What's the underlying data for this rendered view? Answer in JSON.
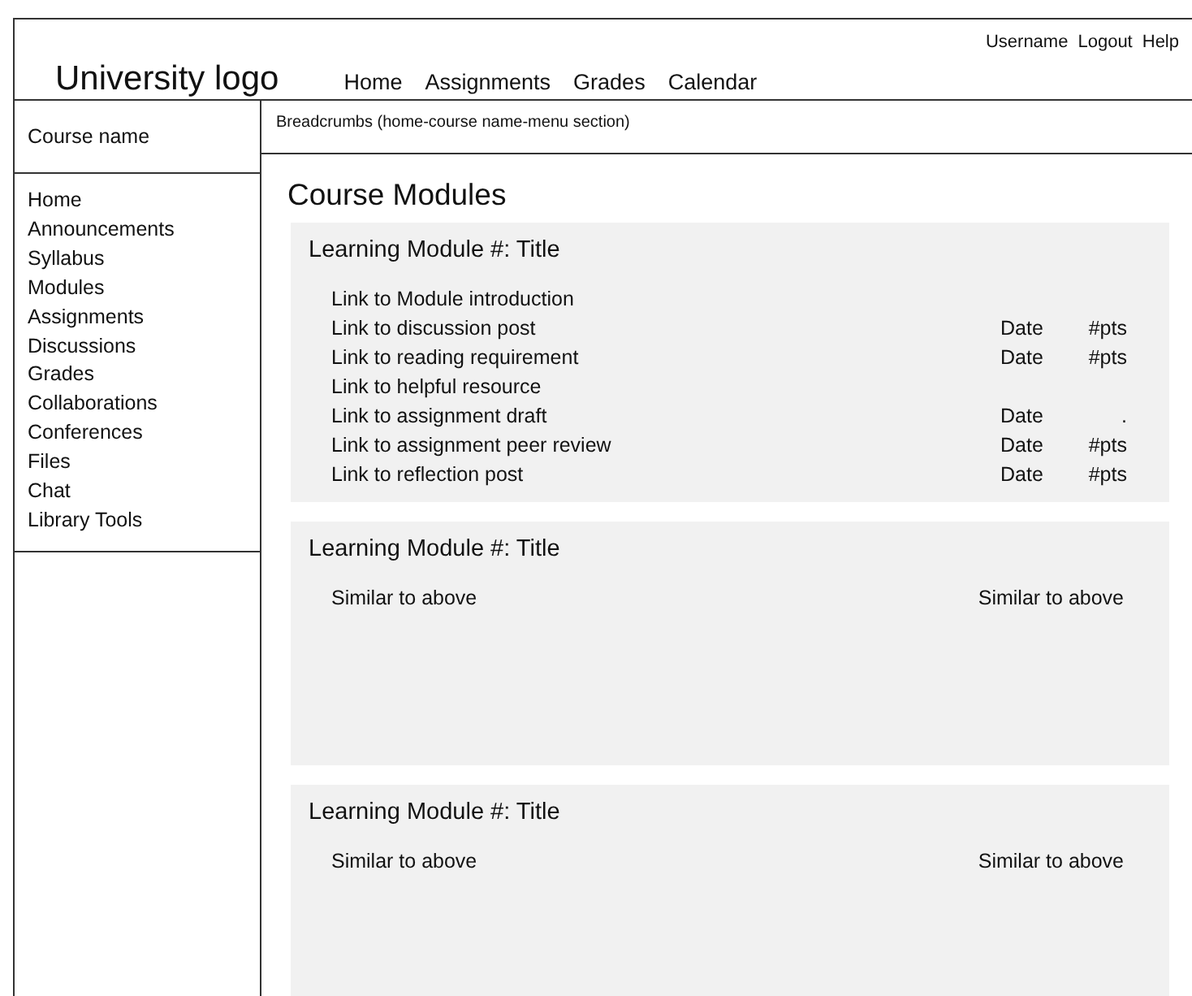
{
  "header": {
    "logo": "University logo",
    "nav": [
      "Home",
      "Assignments",
      "Grades",
      "Calendar"
    ],
    "user_links": [
      "Username",
      "Logout",
      "Help"
    ]
  },
  "sidebar": {
    "course_name": "Course name",
    "items": [
      "Home",
      "Announcements",
      "Syllabus",
      "Modules",
      "Assignments",
      "Discussions",
      "Grades",
      "Collaborations",
      "Conferences",
      "Files",
      "Chat",
      "Library Tools"
    ]
  },
  "breadcrumbs": "Breadcrumbs (home-course name-menu section)",
  "page_title": "Course Modules",
  "modules": [
    {
      "title": "Learning Module #: Title",
      "items": [
        {
          "kind": "link",
          "label": "Link to Module introduction"
        },
        {
          "kind": "link",
          "label": "Link to discussion post",
          "date": "Date",
          "points": "#pts"
        },
        {
          "kind": "link",
          "label": "Link to reading requirement",
          "date": "Date",
          "points": "#pts"
        },
        {
          "kind": "link",
          "label": "Link to helpful resource"
        },
        {
          "kind": "link",
          "label": "Link to assignment draft",
          "date": "Date",
          "points": "."
        },
        {
          "kind": "link",
          "label": "Link to assignment peer review",
          "date": "Date",
          "points": "#pts"
        },
        {
          "kind": "link",
          "label": "Link to reflection post",
          "date": "Date",
          "points": "#pts"
        }
      ]
    },
    {
      "title": "Learning Module #: Title",
      "items": [
        {
          "kind": "note",
          "label": "Similar to above",
          "note": "Similar to above"
        }
      ]
    },
    {
      "title": "Learning Module #: Title",
      "items": [
        {
          "kind": "note",
          "label": "Similar to above",
          "note": "Similar to above"
        }
      ]
    }
  ]
}
